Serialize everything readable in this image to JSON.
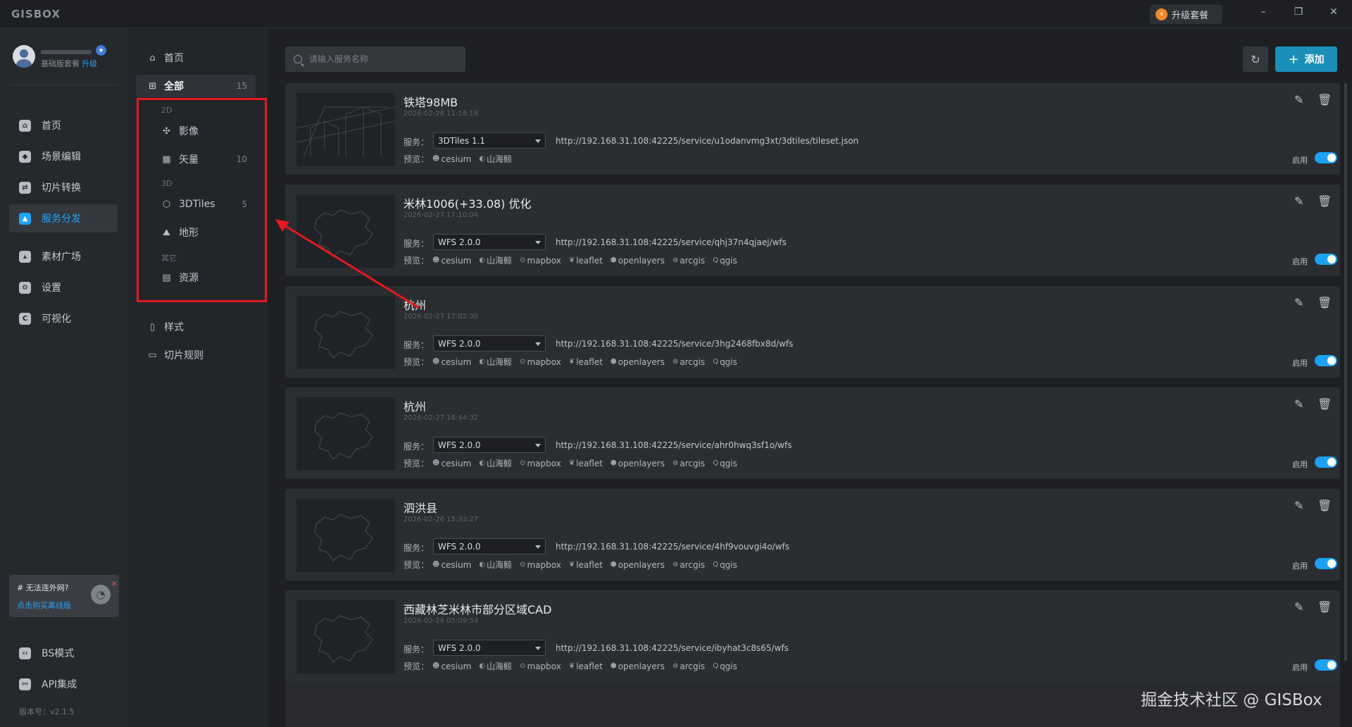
{
  "app": {
    "logo": "GISBOX",
    "upgrade_label": "升级套餐"
  },
  "user": {
    "plan": "基础版套餐",
    "upgrade_link": "升级"
  },
  "nav": {
    "items": [
      {
        "label": "首页",
        "icon": "home-icon"
      },
      {
        "label": "场景编辑",
        "icon": "cube-icon"
      },
      {
        "label": "切片转换",
        "icon": "convert-icon"
      },
      {
        "label": "服务分发",
        "icon": "upload-cloud-icon",
        "active": true
      },
      {
        "label": "素材广场",
        "icon": "image-icon"
      },
      {
        "label": "设置",
        "icon": "gear-icon"
      },
      {
        "label": "可视化",
        "icon": "chart-icon"
      }
    ],
    "offline_card": {
      "title": "# 无法连外网?",
      "link": "点击购买离线版"
    },
    "bottom_items": [
      {
        "label": "BS模式",
        "icon": "code-icon"
      },
      {
        "label": "API集成",
        "icon": "api-icon"
      }
    ],
    "version": "版本号：v2.1.5"
  },
  "subnav": {
    "home": "首页",
    "all": {
      "label": "全部",
      "count": "15"
    },
    "group_2d": "2D",
    "imagery": "影像",
    "vector": {
      "label": "矢量",
      "count": "10"
    },
    "group_3d": "3D",
    "tiles3d": {
      "label": "3DTiles",
      "count": "5"
    },
    "terrain": "地形",
    "group_other": "其它",
    "resource": "资源",
    "style": "样式",
    "tile_rule": "切片规则"
  },
  "toolbar": {
    "search_placeholder": "请输入服务名称",
    "add_label": "添加"
  },
  "labels": {
    "service": "服务：",
    "preview": "预览：",
    "enable": "启用"
  },
  "cards": [
    {
      "title": "铁塔98MB",
      "date": "2026-02-28 11:18:18",
      "service": "3DTiles 1.1",
      "url": "http://192.168.31.108:42225/service/u1odanvmg3xt/3dtiles/tileset.json",
      "previews": [
        "cesium",
        "山海鲸"
      ],
      "enabled": true
    },
    {
      "title": "米林1006(+33.08) 优化",
      "date": "2026-02-27 17:10:04",
      "service": "WFS 2.0.0",
      "url": "http://192.168.31.108:42225/service/qhj37n4qjaej/wfs",
      "previews": [
        "cesium",
        "山海鲸",
        "mapbox",
        "leaflet",
        "openlayers",
        "arcgis",
        "qgis"
      ],
      "enabled": true
    },
    {
      "title": "杭州",
      "date": "2026-02-27 17:02:30",
      "service": "WFS 2.0.0",
      "url": "http://192.168.31.108:42225/service/3hg2468fbx8d/wfs",
      "previews": [
        "cesium",
        "山海鲸",
        "mapbox",
        "leaflet",
        "openlayers",
        "arcgis",
        "qgis"
      ],
      "enabled": true
    },
    {
      "title": "杭州",
      "date": "2026-02-27 16:44:32",
      "service": "WFS 2.0.0",
      "url": "http://192.168.31.108:42225/service/ahr0hwq3sf1o/wfs",
      "previews": [
        "cesium",
        "山海鲸",
        "mapbox",
        "leaflet",
        "openlayers",
        "arcgis",
        "qgis"
      ],
      "enabled": true
    },
    {
      "title": "泗洪县",
      "date": "2026-02-26 15:33:27",
      "service": "WFS 2.0.0",
      "url": "http://192.168.31.108:42225/service/4hf9vouvgi4o/wfs",
      "previews": [
        "cesium",
        "山海鲸",
        "mapbox",
        "leaflet",
        "openlayers",
        "arcgis",
        "qgis"
      ],
      "enabled": true
    },
    {
      "title": "西藏林芝米林市部分区域CAD",
      "date": "2026-02-26 05:09:54",
      "service": "WFS 2.0.0",
      "url": "http://192.168.31.108:42225/service/ibyhat3c8s65/wfs",
      "previews": [
        "cesium",
        "山海鲸",
        "mapbox",
        "leaflet",
        "openlayers",
        "arcgis",
        "qgis"
      ],
      "enabled": true
    }
  ],
  "watermark": "掘金技术社区 @ GISBox",
  "colors": {
    "accent": "#1ea4ff",
    "add_button": "#1a8fb8",
    "toggle_on": "#1da1f2",
    "highlight_box": "#e6191f",
    "upgrade_bolt": "#f08a24"
  }
}
